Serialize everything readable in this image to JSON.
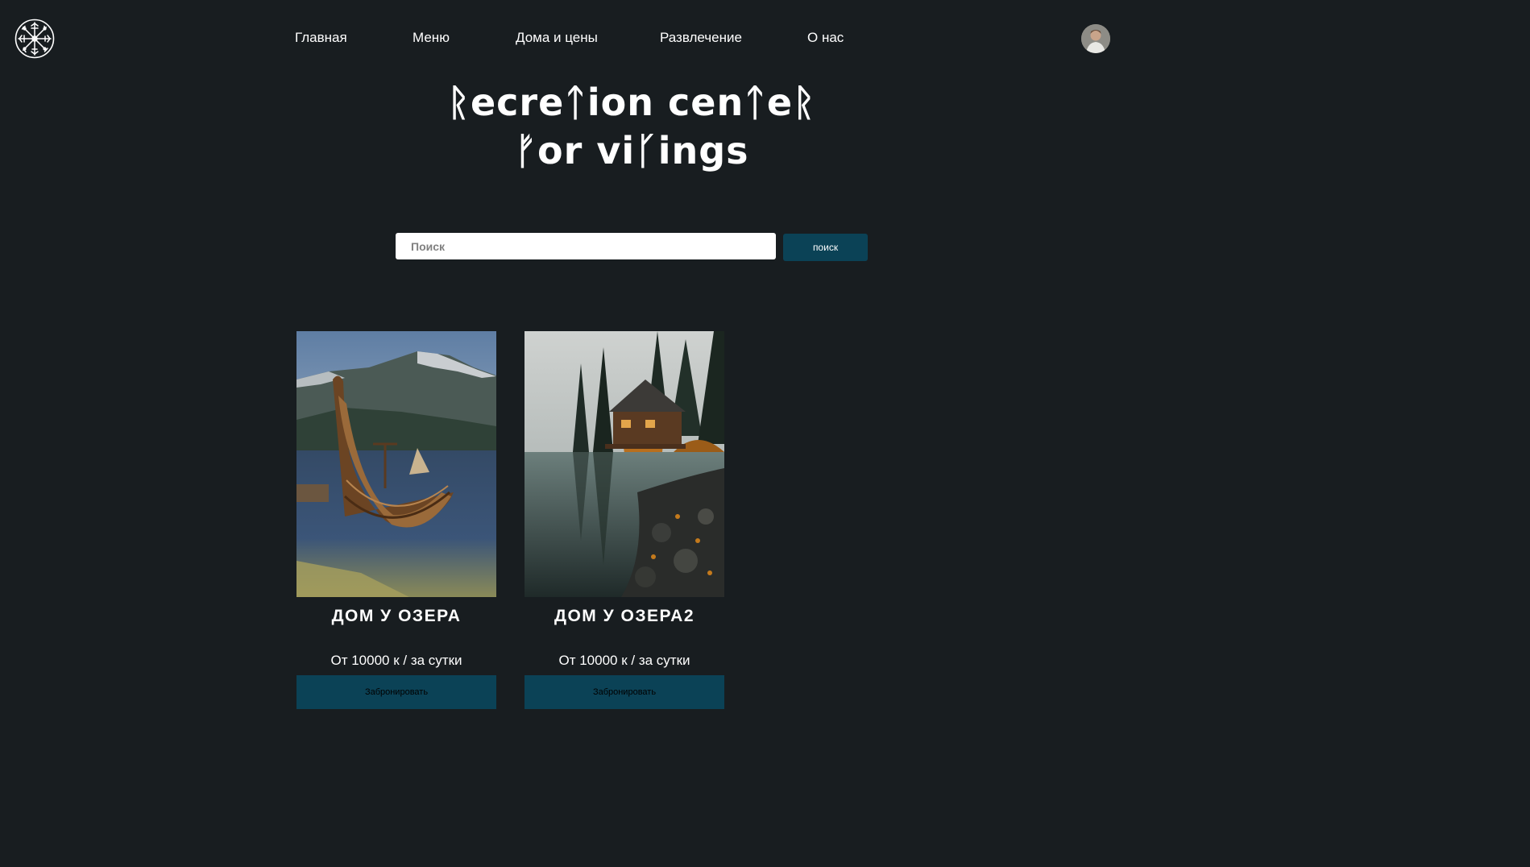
{
  "header": {
    "logo_icon": "vegvisir-rune-compass-icon",
    "nav": [
      {
        "label": "Главная"
      },
      {
        "label": "Меню"
      },
      {
        "label": "Дома и цены"
      },
      {
        "label": "Развлечение"
      },
      {
        "label": "О нас"
      }
    ],
    "avatar_icon": "user-avatar"
  },
  "hero": {
    "title_line1": "ᚱecreᛏion cenᛏeᚱ",
    "title_line2": "ᚠor viᚴings"
  },
  "search": {
    "placeholder": "Поиск",
    "button_label": "поиск"
  },
  "colors": {
    "background": "#181d20",
    "accent": "#0b4256",
    "text": "#ffffff"
  },
  "cards": [
    {
      "title": "ДОМ У ОЗЕРА",
      "price": "От 10000 к / за сутки",
      "button_label": "Забронировать",
      "image": "viking-longship-on-mountain-lake"
    },
    {
      "title": "ДОМ У ОЗЕРА2",
      "price": "От 10000 к / за сутки",
      "button_label": "Забронировать",
      "image": "wooden-cabin-by-forest-lake"
    }
  ]
}
